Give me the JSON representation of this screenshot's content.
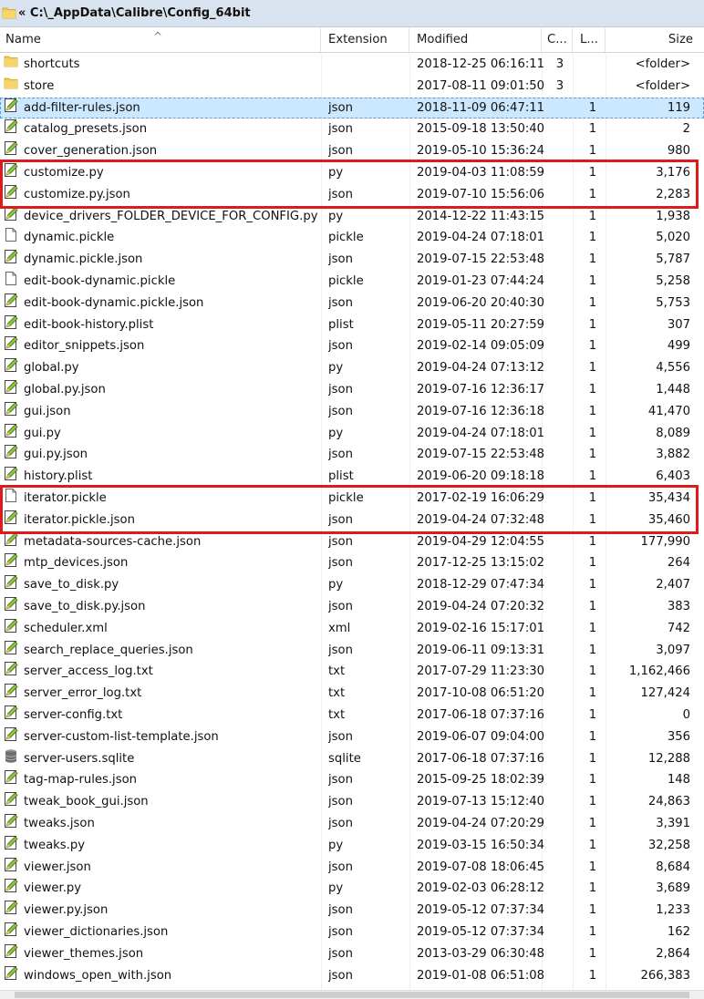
{
  "window": {
    "path": "« C:\\_AppData\\Calibre\\Config_64bit"
  },
  "columns": {
    "name": "Name",
    "extension": "Extension",
    "modified": "Modified",
    "c": "C...",
    "l": "L...",
    "size": "Size"
  },
  "files": [
    {
      "name": "shortcuts",
      "ext": "",
      "modified": "2018-12-25 06:16:11",
      "c": "3",
      "l": "",
      "size": "<folder>",
      "icon": "folder-icon"
    },
    {
      "name": "store",
      "ext": "",
      "modified": "2017-08-11 09:01:50",
      "c": "3",
      "l": "",
      "size": "<folder>",
      "icon": "folder-icon"
    },
    {
      "name": "add-filter-rules.json",
      "ext": "json",
      "modified": "2018-11-09 06:47:11",
      "c": "",
      "l": "1",
      "size": "119",
      "icon": "edit-file-icon"
    },
    {
      "name": "catalog_presets.json",
      "ext": "json",
      "modified": "2015-09-18 13:50:40",
      "c": "",
      "l": "1",
      "size": "2",
      "icon": "edit-file-icon"
    },
    {
      "name": "cover_generation.json",
      "ext": "json",
      "modified": "2019-05-10 15:36:24",
      "c": "",
      "l": "1",
      "size": "980",
      "icon": "edit-file-icon"
    },
    {
      "name": "customize.py",
      "ext": "py",
      "modified": "2019-04-03 11:08:59",
      "c": "",
      "l": "1",
      "size": "3,176",
      "icon": "edit-file-icon"
    },
    {
      "name": "customize.py.json",
      "ext": "json",
      "modified": "2019-07-10 15:56:06",
      "c": "",
      "l": "1",
      "size": "2,283",
      "icon": "edit-file-icon"
    },
    {
      "name": "device_drivers_FOLDER_DEVICE_FOR_CONFIG.py",
      "ext": "py",
      "modified": "2014-12-22 11:43:15",
      "c": "",
      "l": "1",
      "size": "1,938",
      "icon": "edit-file-icon"
    },
    {
      "name": "dynamic.pickle",
      "ext": "pickle",
      "modified": "2019-04-24 07:18:01",
      "c": "",
      "l": "1",
      "size": "5,020",
      "icon": "blank-file-icon"
    },
    {
      "name": "dynamic.pickle.json",
      "ext": "json",
      "modified": "2019-07-15 22:53:48",
      "c": "",
      "l": "1",
      "size": "5,787",
      "icon": "edit-file-icon"
    },
    {
      "name": "edit-book-dynamic.pickle",
      "ext": "pickle",
      "modified": "2019-01-23 07:44:24",
      "c": "",
      "l": "1",
      "size": "5,258",
      "icon": "blank-file-icon"
    },
    {
      "name": "edit-book-dynamic.pickle.json",
      "ext": "json",
      "modified": "2019-06-20 20:40:30",
      "c": "",
      "l": "1",
      "size": "5,753",
      "icon": "edit-file-icon"
    },
    {
      "name": "edit-book-history.plist",
      "ext": "plist",
      "modified": "2019-05-11 20:27:59",
      "c": "",
      "l": "1",
      "size": "307",
      "icon": "edit-file-icon"
    },
    {
      "name": "editor_snippets.json",
      "ext": "json",
      "modified": "2019-02-14 09:05:09",
      "c": "",
      "l": "1",
      "size": "499",
      "icon": "edit-file-icon"
    },
    {
      "name": "global.py",
      "ext": "py",
      "modified": "2019-04-24 07:13:12",
      "c": "",
      "l": "1",
      "size": "4,556",
      "icon": "edit-file-icon"
    },
    {
      "name": "global.py.json",
      "ext": "json",
      "modified": "2019-07-16 12:36:17",
      "c": "",
      "l": "1",
      "size": "1,448",
      "icon": "edit-file-icon"
    },
    {
      "name": "gui.json",
      "ext": "json",
      "modified": "2019-07-16 12:36:18",
      "c": "",
      "l": "1",
      "size": "41,470",
      "icon": "edit-file-icon"
    },
    {
      "name": "gui.py",
      "ext": "py",
      "modified": "2019-04-24 07:18:01",
      "c": "",
      "l": "1",
      "size": "8,089",
      "icon": "edit-file-icon"
    },
    {
      "name": "gui.py.json",
      "ext": "json",
      "modified": "2019-07-15 22:53:48",
      "c": "",
      "l": "1",
      "size": "3,882",
      "icon": "edit-file-icon"
    },
    {
      "name": "history.plist",
      "ext": "plist",
      "modified": "2019-06-20 09:18:18",
      "c": "",
      "l": "1",
      "size": "6,403",
      "icon": "edit-file-icon"
    },
    {
      "name": "iterator.pickle",
      "ext": "pickle",
      "modified": "2017-02-19 16:06:29",
      "c": "",
      "l": "1",
      "size": "35,434",
      "icon": "blank-file-icon"
    },
    {
      "name": "iterator.pickle.json",
      "ext": "json",
      "modified": "2019-04-24 07:32:48",
      "c": "",
      "l": "1",
      "size": "35,460",
      "icon": "edit-file-icon"
    },
    {
      "name": "metadata-sources-cache.json",
      "ext": "json",
      "modified": "2019-04-29 12:04:55",
      "c": "",
      "l": "1",
      "size": "177,990",
      "icon": "edit-file-icon"
    },
    {
      "name": "mtp_devices.json",
      "ext": "json",
      "modified": "2017-12-25 13:15:02",
      "c": "",
      "l": "1",
      "size": "264",
      "icon": "edit-file-icon"
    },
    {
      "name": "save_to_disk.py",
      "ext": "py",
      "modified": "2018-12-29 07:47:34",
      "c": "",
      "l": "1",
      "size": "2,407",
      "icon": "edit-file-icon"
    },
    {
      "name": "save_to_disk.py.json",
      "ext": "json",
      "modified": "2019-04-24 07:20:32",
      "c": "",
      "l": "1",
      "size": "383",
      "icon": "edit-file-icon"
    },
    {
      "name": "scheduler.xml",
      "ext": "xml",
      "modified": "2019-02-16 15:17:01",
      "c": "",
      "l": "1",
      "size": "742",
      "icon": "edit-file-icon"
    },
    {
      "name": "search_replace_queries.json",
      "ext": "json",
      "modified": "2019-06-11 09:13:31",
      "c": "",
      "l": "1",
      "size": "3,097",
      "icon": "edit-file-icon"
    },
    {
      "name": "server_access_log.txt",
      "ext": "txt",
      "modified": "2017-07-29 11:23:30",
      "c": "",
      "l": "1",
      "size": "1,162,466",
      "icon": "edit-file-icon"
    },
    {
      "name": "server_error_log.txt",
      "ext": "txt",
      "modified": "2017-10-08 06:51:20",
      "c": "",
      "l": "1",
      "size": "127,424",
      "icon": "edit-file-icon"
    },
    {
      "name": "server-config.txt",
      "ext": "txt",
      "modified": "2017-06-18 07:37:16",
      "c": "",
      "l": "1",
      "size": "0",
      "icon": "edit-file-icon"
    },
    {
      "name": "server-custom-list-template.json",
      "ext": "json",
      "modified": "2019-06-07 09:04:00",
      "c": "",
      "l": "1",
      "size": "356",
      "icon": "edit-file-icon"
    },
    {
      "name": "server-users.sqlite",
      "ext": "sqlite",
      "modified": "2017-06-18 07:37:16",
      "c": "",
      "l": "1",
      "size": "12,288",
      "icon": "database-icon"
    },
    {
      "name": "tag-map-rules.json",
      "ext": "json",
      "modified": "2015-09-25 18:02:39",
      "c": "",
      "l": "1",
      "size": "148",
      "icon": "edit-file-icon"
    },
    {
      "name": "tweak_book_gui.json",
      "ext": "json",
      "modified": "2019-07-13 15:12:40",
      "c": "",
      "l": "1",
      "size": "24,863",
      "icon": "edit-file-icon"
    },
    {
      "name": "tweaks.json",
      "ext": "json",
      "modified": "2019-04-24 07:20:29",
      "c": "",
      "l": "1",
      "size": "3,391",
      "icon": "edit-file-icon"
    },
    {
      "name": "tweaks.py",
      "ext": "py",
      "modified": "2019-03-15 16:50:34",
      "c": "",
      "l": "1",
      "size": "32,258",
      "icon": "edit-file-icon"
    },
    {
      "name": "viewer.json",
      "ext": "json",
      "modified": "2019-07-08 18:06:45",
      "c": "",
      "l": "1",
      "size": "8,684",
      "icon": "edit-file-icon"
    },
    {
      "name": "viewer.py",
      "ext": "py",
      "modified": "2019-02-03 06:28:12",
      "c": "",
      "l": "1",
      "size": "3,689",
      "icon": "edit-file-icon"
    },
    {
      "name": "viewer.py.json",
      "ext": "json",
      "modified": "2019-05-12 07:37:34",
      "c": "",
      "l": "1",
      "size": "1,233",
      "icon": "edit-file-icon"
    },
    {
      "name": "viewer_dictionaries.json",
      "ext": "json",
      "modified": "2019-05-12 07:37:34",
      "c": "",
      "l": "1",
      "size": "162",
      "icon": "edit-file-icon"
    },
    {
      "name": "viewer_themes.json",
      "ext": "json",
      "modified": "2013-03-29 06:30:48",
      "c": "",
      "l": "1",
      "size": "2,864",
      "icon": "edit-file-icon"
    },
    {
      "name": "windows_open_with.json",
      "ext": "json",
      "modified": "2019-01-08 06:51:08",
      "c": "",
      "l": "1",
      "size": "266,383",
      "icon": "edit-file-icon"
    }
  ],
  "selected_index": 2,
  "highlights": [
    [
      5,
      6
    ],
    [
      20,
      21
    ]
  ],
  "colors": {
    "highlight_border": "#e01a1a",
    "selection": "#cce8ff",
    "titlebar": "#d8e3ef"
  }
}
